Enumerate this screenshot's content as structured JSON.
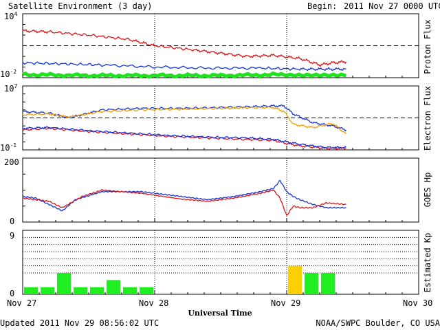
{
  "header": {
    "title": "Satellite Environment (3 day)",
    "begin_label": "Begin:",
    "begin_value": "2011 Nov 27 0000 UTC"
  },
  "footer": {
    "updated": "Updated 2011 Nov 29 08:56:02 UTC",
    "credit": "NOAA/SWPC Boulder, CO USA",
    "xlabel": "Universal Time"
  },
  "x_ticks": [
    "Nov 27",
    "Nov 28",
    "Nov 29",
    "Nov 30"
  ],
  "colors": {
    "red": "#e01010",
    "blue": "#1030e0",
    "green": "#20e020",
    "orange": "#f0a000",
    "kp_green": "#20ee20",
    "kp_yellow": "#ffd000"
  },
  "chart_data": [
    {
      "type": "line",
      "panel": "proton",
      "ylabel": "Proton Flux",
      "yscale": "log",
      "ylim_exp": [
        -2,
        4
      ],
      "ytick_base": "10",
      "ytick_top_exp": "4",
      "ytick_bottom_exp": "-2",
      "threshold_exp": 1,
      "xlim_days": [
        0,
        3
      ],
      "series": [
        {
          "color": "red",
          "x": [
            0,
            0.2,
            0.5,
            0.8,
            1.0,
            1.3,
            1.5,
            1.7,
            1.9,
            2.1,
            2.25,
            2.35,
            2.45
          ],
          "log_y": [
            2.4,
            2.3,
            2.0,
            1.6,
            1.0,
            0.6,
            0.3,
            0.0,
            0.1,
            -0.2,
            -0.8,
            -0.6,
            -0.5
          ]
        },
        {
          "color": "blue",
          "x": [
            0,
            0.3,
            0.6,
            1.0,
            1.4,
            1.8,
            2.1,
            2.3,
            2.45
          ],
          "log_y": [
            -0.6,
            -0.7,
            -0.8,
            -1.0,
            -1.1,
            -1.1,
            -1.2,
            -1.2,
            -1.2
          ]
        },
        {
          "color": "green",
          "x": [
            0,
            0.5,
            1.0,
            1.5,
            2.0,
            2.45
          ],
          "log_y": [
            -1.7,
            -1.8,
            -1.8,
            -1.8,
            -1.7,
            -1.8
          ]
        }
      ]
    },
    {
      "type": "line",
      "panel": "electron",
      "ylabel": "Electron Flux",
      "yscale": "log",
      "ylim_exp": [
        -1,
        7
      ],
      "ytick_base": "10",
      "ytick_top_exp": "7",
      "ytick_bottom_exp": "-1",
      "threshold_exp": 3,
      "xlim_days": [
        0,
        3
      ],
      "series": [
        {
          "color": "blue",
          "x": [
            0,
            0.2,
            0.35,
            0.6,
            0.9,
            1.2,
            1.5,
            1.7,
            1.9,
            1.98,
            2.05,
            2.2,
            2.35,
            2.45
          ],
          "log_y": [
            3.8,
            3.6,
            3.0,
            4.0,
            4.2,
            4.2,
            4.3,
            4.4,
            4.5,
            4.5,
            3.5,
            2.4,
            2.0,
            1.5
          ]
        },
        {
          "color": "orange",
          "x": [
            0,
            0.2,
            0.35,
            0.6,
            0.9,
            1.2,
            1.5,
            1.7,
            1.9,
            1.98,
            2.05,
            2.2,
            2.35,
            2.45
          ],
          "log_y": [
            3.4,
            3.5,
            3.1,
            3.8,
            4.0,
            4.1,
            4.2,
            4.3,
            4.3,
            3.8,
            2.2,
            1.8,
            2.3,
            1.0
          ]
        },
        {
          "color": "red",
          "x": [
            0,
            0.2,
            0.5,
            0.8,
            1.1,
            1.4,
            1.7,
            1.9,
            2.0,
            2.1,
            2.3,
            2.45
          ],
          "log_y": [
            1.5,
            1.7,
            1.3,
            1.0,
            0.7,
            0.5,
            0.3,
            0.2,
            -0.2,
            -0.5,
            -0.8,
            -0.8
          ]
        },
        {
          "color": "blue",
          "x": [
            0,
            0.2,
            0.5,
            0.8,
            1.1,
            1.4,
            1.7,
            1.9,
            2.0,
            2.1,
            2.3,
            2.45
          ],
          "log_y": [
            1.7,
            1.8,
            1.4,
            1.1,
            0.8,
            0.6,
            0.5,
            0.3,
            0.0,
            -0.3,
            -0.7,
            -0.7
          ]
        }
      ]
    },
    {
      "type": "line",
      "panel": "goes_hp",
      "ylabel": "GOES Hp",
      "yscale": "linear",
      "ylim": [
        0,
        200
      ],
      "yticks": [
        "0",
        "200"
      ],
      "xlim_days": [
        0,
        3
      ],
      "series": [
        {
          "color": "blue",
          "x": [
            0,
            0.1,
            0.2,
            0.3,
            0.4,
            0.6,
            0.9,
            1.2,
            1.4,
            1.6,
            1.8,
            1.9,
            1.95,
            2.0,
            2.05,
            2.1,
            2.2,
            2.3,
            2.45
          ],
          "y": [
            80,
            75,
            55,
            35,
            70,
            95,
            95,
            80,
            70,
            80,
            95,
            105,
            130,
            95,
            80,
            70,
            55,
            45,
            45
          ]
        },
        {
          "color": "red",
          "x": [
            0,
            0.1,
            0.2,
            0.3,
            0.45,
            0.6,
            0.9,
            1.2,
            1.4,
            1.6,
            1.8,
            1.9,
            1.95,
            2.0,
            2.05,
            2.1,
            2.2,
            2.3,
            2.45
          ],
          "y": [
            75,
            70,
            65,
            45,
            80,
            100,
            90,
            72,
            65,
            75,
            90,
            100,
            75,
            20,
            50,
            45,
            45,
            60,
            55
          ]
        }
      ]
    },
    {
      "type": "bar",
      "panel": "kp",
      "ylabel": "Estimated Kp",
      "ylim": [
        0,
        9
      ],
      "yticks": [
        "0",
        "9"
      ],
      "bin_hours": 3,
      "values": [
        1,
        1,
        3,
        1,
        1,
        2,
        1,
        1,
        0.1,
        0.1,
        0.1,
        0.1,
        0.1,
        0.1,
        0.1,
        0.1,
        4,
        3,
        3
      ],
      "bar_colors": [
        "kp_green",
        "kp_green",
        "kp_green",
        "kp_green",
        "kp_green",
        "kp_green",
        "kp_green",
        "kp_green",
        "kp_green",
        "kp_green",
        "kp_green",
        "kp_green",
        "kp_green",
        "kp_green",
        "kp_green",
        "kp_green",
        "kp_yellow",
        "kp_green",
        "kp_green"
      ]
    }
  ]
}
